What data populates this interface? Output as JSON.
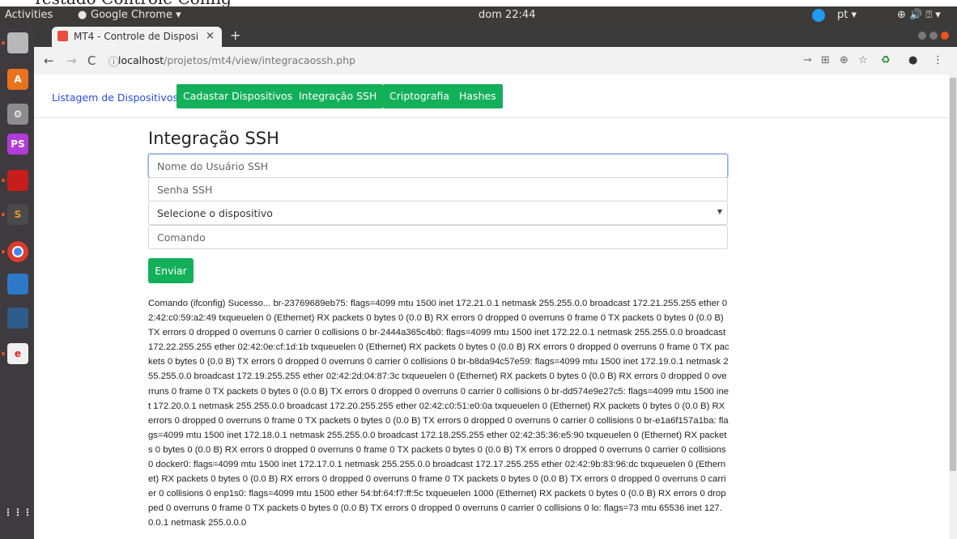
{
  "page_clip": {
    "text": "Testado Controle Config"
  },
  "topbar": {
    "activities": "Activities",
    "app_name": "Google Chrome ▾",
    "clock": "dom 22:44",
    "language": "pt ▾",
    "system_icons": "⊕ 🔊 ⍰ ▾"
  },
  "dock": {
    "items": [
      {
        "icon": "files-icon"
      },
      {
        "icon": "software-center-icon"
      },
      {
        "icon": "settings-icon"
      },
      {
        "icon": "phpstorm-icon",
        "label": "PS"
      },
      {
        "icon": "terminal-icon"
      },
      {
        "icon": "sublime-icon",
        "label": "S"
      },
      {
        "icon": "chrome-icon"
      },
      {
        "icon": "document-icon"
      },
      {
        "icon": "mysql-icon"
      },
      {
        "icon": "editor-icon"
      }
    ],
    "apps_grid": "⋮⋮⋮"
  },
  "browser": {
    "tab_title": "MT4 - Controle de Disposi",
    "tab_close": "×",
    "new_tab": "+",
    "url_host": "localhost",
    "url_path": "/projetos/mt4/view/integracaossh.php",
    "url_info": "ⓘ"
  },
  "nav": {
    "link_listagem": "Listagem de Dispositivos",
    "btn_cadastrar": "Cadastar Dispositivos",
    "btn_ssh": "Integração SSH",
    "btn_cripto": "Criptografia",
    "btn_hashes": "Hashes"
  },
  "form": {
    "title": "Integração SSH",
    "user_placeholder": "Nome do Usuário SSH",
    "password_placeholder": "Senha SSH",
    "device_select": "Selecione o dispositivo",
    "command_placeholder": "Comando",
    "submit_label": "Enviar"
  },
  "output": {
    "text": "Comando (ifconfig) Sucesso... br-23769689eb75: flags=4099 mtu 1500 inet 172.21.0.1 netmask 255.255.0.0 broadcast 172.21.255.255 ether 02:42:c0:59:a2:49 txqueuelen 0 (Ethernet) RX packets 0 bytes 0 (0.0 B) RX errors 0 dropped 0 overruns 0 frame 0 TX packets 0 bytes 0 (0.0 B) TX errors 0 dropped 0 overruns 0 carrier 0 collisions 0 br-2444a365c4b0: flags=4099 mtu 1500 inet 172.22.0.1 netmask 255.255.0.0 broadcast 172.22.255.255 ether 02:42:0e:cf:1d:1b txqueuelen 0 (Ethernet) RX packets 0 bytes 0 (0.0 B) RX errors 0 dropped 0 overruns 0 frame 0 TX packets 0 bytes 0 (0.0 B) TX errors 0 dropped 0 overruns 0 carrier 0 collisions 0 br-b8da94c57e59: flags=4099 mtu 1500 inet 172.19.0.1 netmask 255.255.0.0 broadcast 172.19.255.255 ether 02:42:2d:04:87:3c txqueuelen 0 (Ethernet) RX packets 0 bytes 0 (0.0 B) RX errors 0 dropped 0 overruns 0 frame 0 TX packets 0 bytes 0 (0.0 B) TX errors 0 dropped 0 overruns 0 carrier 0 collisions 0 br-dd574e9e27c5: flags=4099 mtu 1500 inet 172.20.0.1 netmask 255.255.0.0 broadcast 172.20.255.255 ether 02:42:c0:51:e0:0a txqueuelen 0 (Ethernet) RX packets 0 bytes 0 (0.0 B) RX errors 0 dropped 0 overruns 0 frame 0 TX packets 0 bytes 0 (0.0 B) TX errors 0 dropped 0 overruns 0 carrier 0 collisions 0 br-e1a6f157a1ba: flags=4099 mtu 1500 inet 172.18.0.1 netmask 255.255.0.0 broadcast 172.18.255.255 ether 02:42:35:36:e5:90 txqueuelen 0 (Ethernet) RX packets 0 bytes 0 (0.0 B) RX errors 0 dropped 0 overruns 0 frame 0 TX packets 0 bytes 0 (0.0 B) TX errors 0 dropped 0 overruns 0 carrier 0 collisions 0 docker0: flags=4099 mtu 1500 inet 172.17.0.1 netmask 255.255.0.0 broadcast 172.17.255.255 ether 02:42:9b:83:96:dc txqueuelen 0 (Ethernet) RX packets 0 bytes 0 (0.0 B) RX errors 0 dropped 0 overruns 0 frame 0 TX packets 0 bytes 0 (0.0 B) TX errors 0 dropped 0 overruns 0 carrier 0 collisions 0 enp1s0: flags=4099 mtu 1500 ether 54:bf:64:f7:ff:5c txqueuelen 1000 (Ethernet) RX packets 0 bytes 0 (0.0 B) RX errors 0 dropped 0 overruns 0 frame 0 TX packets 0 bytes 0 (0.0 B) TX errors 0 dropped 0 overruns 0 carrier 0 collisions 0 lo: flags=73 mtu 65536 inet 127.0.0.1 netmask 255.0.0.0"
  },
  "colors": {
    "accent_green": "#13b05a",
    "link_blue": "#2a4de0",
    "focus_border": "#8ea8ef"
  }
}
